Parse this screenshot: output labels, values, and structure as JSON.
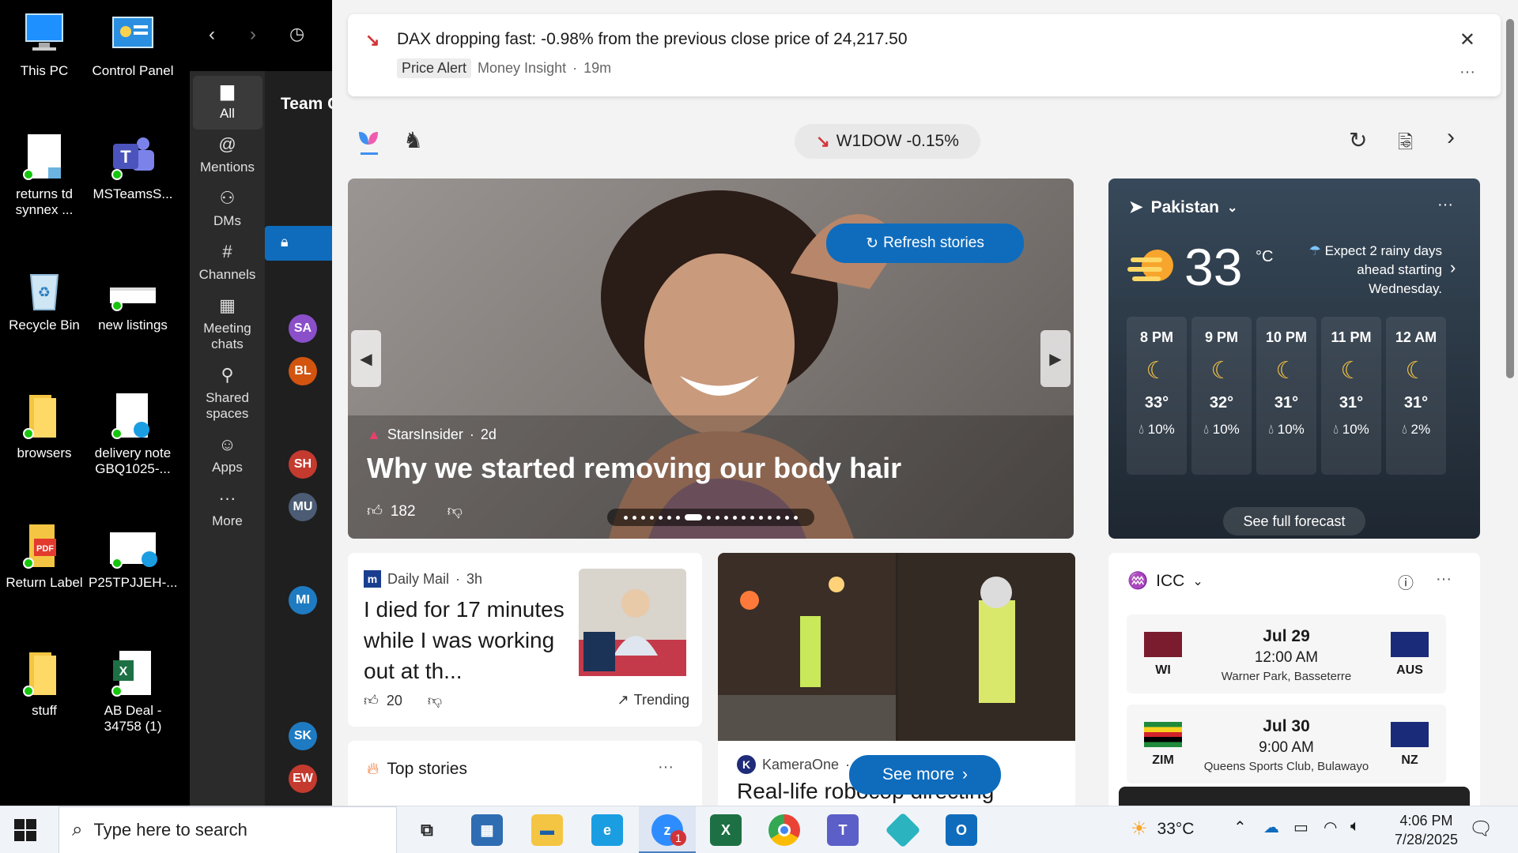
{
  "desktop": {
    "icons": [
      {
        "label": "This PC"
      },
      {
        "label": "Control Panel"
      },
      {
        "label": "returns td synnex ..."
      },
      {
        "label": "MSTeamsS..."
      },
      {
        "label": "Recycle Bin"
      },
      {
        "label": "new listings"
      },
      {
        "label": "browsers"
      },
      {
        "label": "delivery note GBQ1025-..."
      },
      {
        "label": "Return Label"
      },
      {
        "label": "P25TPJJEH-..."
      },
      {
        "label": "stuff"
      },
      {
        "label": "AB Deal - 34758 (1)"
      }
    ]
  },
  "teams": {
    "title": "Team C",
    "rail": [
      {
        "label": "All",
        "icon": "chat-icon"
      },
      {
        "label": "Mentions",
        "icon": "at-icon"
      },
      {
        "label": "DMs",
        "icon": "people-icon"
      },
      {
        "label": "Channels",
        "icon": "hash-icon"
      },
      {
        "label": "Meeting chats",
        "icon": "calendar-icon"
      },
      {
        "label": "Shared spaces",
        "icon": "share-icon"
      },
      {
        "label": "Apps",
        "icon": "apps-icon"
      },
      {
        "label": "More",
        "icon": "more-icon"
      }
    ],
    "avatars": [
      {
        "initials": "SA",
        "color": "#8a4fc9"
      },
      {
        "initials": "BL",
        "color": "#d2540f"
      },
      {
        "initials": "SH",
        "color": "#c43a2e"
      },
      {
        "initials": "MU",
        "color": "#4b5c74"
      },
      {
        "initials": "MI",
        "color": "#1e7bc2"
      },
      {
        "initials": "SK",
        "color": "#1e7bc2"
      },
      {
        "initials": "EW",
        "color": "#c43a2e"
      }
    ]
  },
  "alert": {
    "title": "DAX dropping fast: -0.98% from the previous close price of 24,217.50",
    "tag": "Price Alert",
    "source": "Money Insight",
    "time": "19m"
  },
  "toolbar": {
    "ticker": "W1DOW -0.15%"
  },
  "hero": {
    "refresh": "Refresh stories",
    "source": "StarsInsider",
    "age": "2d",
    "headline": "Why we started removing our body hair",
    "likes": "182"
  },
  "weather": {
    "location": "Pakistan",
    "temp": "33",
    "unit": "°C",
    "summary": "Expect 2 rainy days ahead starting Wednesday.",
    "hours": [
      {
        "time": "8 PM",
        "temp": "33°",
        "precip": "10%"
      },
      {
        "time": "9 PM",
        "temp": "32°",
        "precip": "10%"
      },
      {
        "time": "10 PM",
        "temp": "31°",
        "precip": "10%"
      },
      {
        "time": "11 PM",
        "temp": "31°",
        "precip": "10%"
      },
      {
        "time": "12 AM",
        "temp": "31°",
        "precip": "2%"
      }
    ],
    "forecast_button": "See full forecast"
  },
  "story1": {
    "source": "Daily Mail",
    "age": "3h",
    "headline": "I died for 17 minutes while I was working out at th...",
    "likes": "20",
    "trending": "Trending"
  },
  "story2": {
    "source": "KameraOne",
    "headline": "Real-life robocop directing",
    "see_more": "See more"
  },
  "top_stories": {
    "title": "Top stories"
  },
  "icc": {
    "title": "ICC",
    "matches": [
      {
        "team1": "WI",
        "team2": "AUS",
        "date": "Jul 29",
        "time": "12:00 AM",
        "venue": "Warner Park, Basseterre"
      },
      {
        "team1": "ZIM",
        "team2": "NZ",
        "date": "Jul 30",
        "time": "9:00 AM",
        "venue": "Queens Sports Club, Bulawayo"
      }
    ]
  },
  "taskbar": {
    "search_placeholder": "Type here to search",
    "weather": "33°C",
    "time": "4:06 PM",
    "date": "7/28/2025",
    "zoom_badge": "1"
  }
}
